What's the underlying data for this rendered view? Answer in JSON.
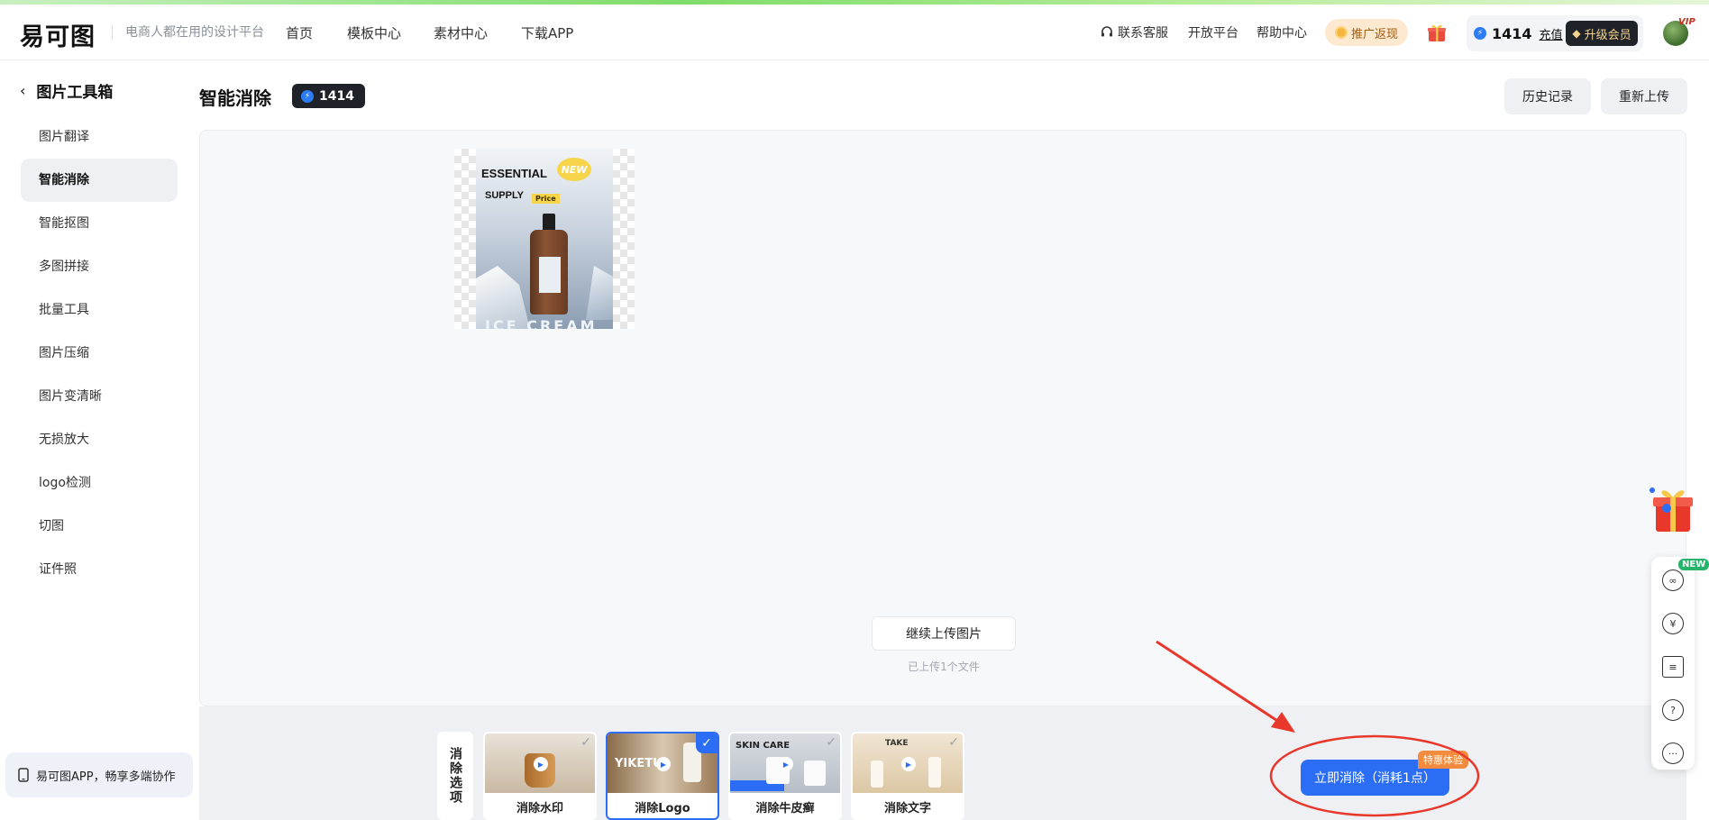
{
  "header": {
    "logo": "易可图",
    "slogan": "电商人都在用的设计平台",
    "nav": [
      "首页",
      "模板中心",
      "素材中心",
      "下载APP"
    ],
    "support": "联系客服",
    "open_platform": "开放平台",
    "help": "帮助中心",
    "promo": "推广返现",
    "points": "1414",
    "recharge": "充值",
    "upgrade": "升级会员",
    "vip_mark": "VIP"
  },
  "sidebar": {
    "title": "图片工具箱",
    "items": [
      {
        "label": "图片翻译"
      },
      {
        "label": "智能消除"
      },
      {
        "label": "智能抠图"
      },
      {
        "label": "多图拼接"
      },
      {
        "label": "批量工具"
      },
      {
        "label": "图片压缩"
      },
      {
        "label": "图片变清晰"
      },
      {
        "label": "无损放大"
      },
      {
        "label": "logo检测"
      },
      {
        "label": "切图"
      },
      {
        "label": "证件照"
      }
    ],
    "active_index": 1,
    "app_promo": "易可图APP，畅享多端协作"
  },
  "main": {
    "title": "智能消除",
    "points_badge": "1414",
    "history_button": "历史记录",
    "reupload_button": "重新上传",
    "poster": {
      "line1": "ESSENTIAL",
      "line2": "SUPPLY",
      "new_badge": "NEW",
      "price": "Price",
      "bottom": "ICE CREAM"
    },
    "continue_upload": "继续上传图片",
    "uploaded_count": "已上传1个文件"
  },
  "options": {
    "label": "消除选项",
    "cards": [
      {
        "caption": "消除水印",
        "selected": false
      },
      {
        "caption": "消除Logo",
        "selected": true,
        "overlay_text": "YIKETU"
      },
      {
        "caption": "消除牛皮癣",
        "selected": false,
        "overlay_text": "SKIN CARE"
      },
      {
        "caption": "消除文字",
        "selected": false,
        "overlay_text": "TAKE"
      }
    ]
  },
  "action": {
    "button": "立即消除（消耗1点）",
    "tag": "特惠体验"
  },
  "floating": {
    "new_tag": "NEW",
    "icons": [
      "link-icon",
      "currency-exchange-icon",
      "notes-icon",
      "help-icon",
      "chat-icon"
    ]
  },
  "colors": {
    "accent": "#2b6ef5",
    "annotation": "#e8382b",
    "promo_orange": "#f28b3d",
    "new_green": "#26b36a"
  }
}
